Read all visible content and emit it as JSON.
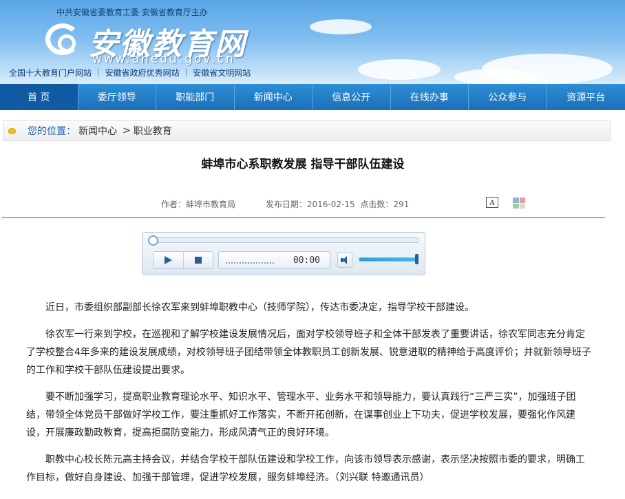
{
  "header": {
    "sponsor": "中共安徽省委教育工委  安徽省教育厅主办",
    "site_name": "安徽教育网",
    "site_url": "www.ahedu.gov.cn",
    "honors": "全国十大教育门户网站 ｜ 安徽省政府优秀网站 ｜ 安徽省文明网站",
    "logo_icon": "at-sign-logo"
  },
  "nav": {
    "items": [
      {
        "label": "首 页",
        "active": true
      },
      {
        "label": "委厅领导"
      },
      {
        "label": "职能部门"
      },
      {
        "label": "新闻中心"
      },
      {
        "label": "信息公开"
      },
      {
        "label": "在线办事"
      },
      {
        "label": "公众参与"
      },
      {
        "label": "资源平台"
      }
    ]
  },
  "breadcrumb": {
    "label": "您的位置：",
    "items": [
      "新闻中心",
      "职业教育"
    ],
    "separator": ">"
  },
  "article": {
    "title": "蚌埠市心系职教发展  指导干部队伍建设",
    "author": "作者：蚌埠市教育局",
    "date": "发布日期：2016-02-15",
    "views": "点击数：291",
    "font_button": "A",
    "paragraphs": [
      "近日，市委组织部副部长徐农军来到蚌埠职教中心（技师学院），传达市委决定，指导学校干部建设。",
      "徐农军一行来到学校，在巡视和了解学校建设发展情况后，面对学校领导班子和全体干部发表了重要讲话，徐农军同志充分肯定了学校整合4年多来的建设发展成绩，对校领导班子团结带领全体教职员工创新发展、锐意进取的精神给于高度评价；并就新领导班子的工作和学校干部队伍建设提出要求。",
      "要不断加强学习，提高职业教育理论水平、知识水平、管理水平、业务水平和领导能力，要认真践行“三严三实”，加强班子团结，带领全体党员干部做好学校工作，要注重抓好工作落实，不断开拓创新，在谋事创业上下功夫，促进学校发展，要强化作风建设，开展廉政勤政教育，提高拒腐防变能力，形成风清气正的良好环境。",
      "职教中心校长陈元高主持会议，并结合学校干部队伍建设和学校工作，向该市领导表示感谢，表示坚决按照市委的要求，明确工作目标，做好自身建设、加强干部管理，促进学校发展，服务蚌埠经济。（刘兴联  特邀通讯员）"
    ]
  },
  "player": {
    "time": "00:00",
    "progress": 0,
    "volume": 1.0
  },
  "colors": {
    "nav_bg": "#1b6fb8",
    "nav_active": "#0f5aa3",
    "crumb_label": "#1a5fae",
    "crumb_dot": "#f2c21b"
  }
}
